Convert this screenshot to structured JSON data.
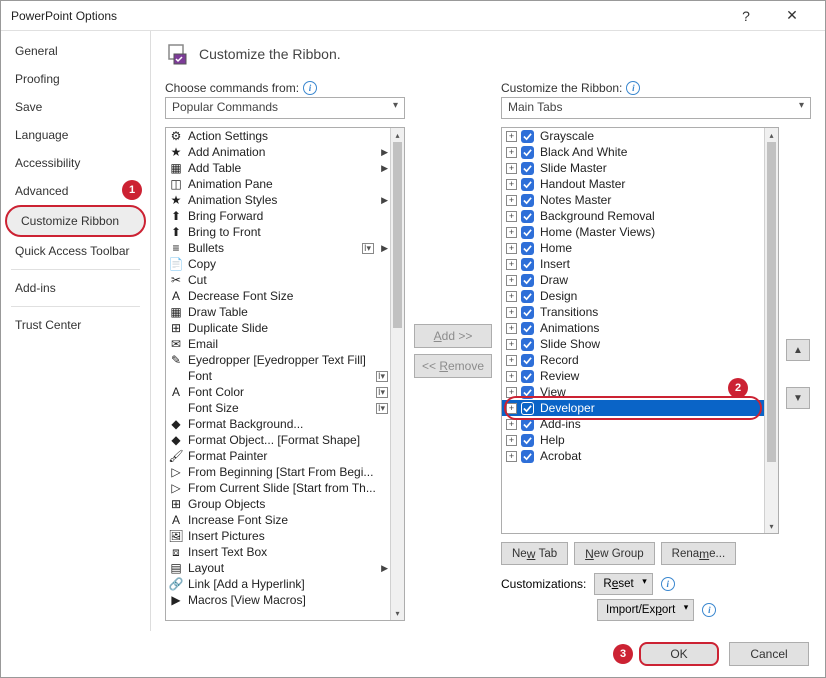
{
  "title": "PowerPoint Options",
  "sidebar": {
    "items": [
      {
        "label": "General"
      },
      {
        "label": "Proofing"
      },
      {
        "label": "Save"
      },
      {
        "label": "Language"
      },
      {
        "label": "Accessibility"
      },
      {
        "label": "Advanced"
      },
      {
        "label": "Customize Ribbon"
      },
      {
        "label": "Quick Access Toolbar"
      },
      {
        "label": "Add-ins"
      },
      {
        "label": "Trust Center"
      }
    ]
  },
  "header": "Customize the Ribbon.",
  "left": {
    "label": "Choose commands from:",
    "dropdown": "Popular Commands",
    "commands": [
      {
        "icon": "⚙",
        "label": "Action Settings"
      },
      {
        "icon": "★",
        "label": "Add Animation",
        "sub": true
      },
      {
        "icon": "▦",
        "label": "Add Table",
        "sub": true
      },
      {
        "icon": "◫",
        "label": "Animation Pane"
      },
      {
        "icon": "★",
        "label": "Animation Styles",
        "sub": true
      },
      {
        "icon": "⬆",
        "label": "Bring Forward"
      },
      {
        "icon": "⬆",
        "label": "Bring to Front"
      },
      {
        "icon": "≡",
        "label": "Bullets",
        "sub": true,
        "size": true
      },
      {
        "icon": "📄",
        "label": "Copy"
      },
      {
        "icon": "✂",
        "label": "Cut"
      },
      {
        "icon": "A",
        "label": "Decrease Font Size"
      },
      {
        "icon": "▦",
        "label": "Draw Table"
      },
      {
        "icon": "⊞",
        "label": "Duplicate Slide"
      },
      {
        "icon": "✉",
        "label": "Email"
      },
      {
        "icon": "✎",
        "label": "Eyedropper [Eyedropper Text Fill]"
      },
      {
        "icon": " ",
        "label": "Font",
        "size": true
      },
      {
        "icon": "A",
        "label": "Font Color",
        "size": true
      },
      {
        "icon": " ",
        "label": "Font Size",
        "size": true
      },
      {
        "icon": "◆",
        "label": "Format Background..."
      },
      {
        "icon": "◆",
        "label": "Format Object... [Format Shape]"
      },
      {
        "icon": "🖌",
        "label": "Format Painter"
      },
      {
        "icon": "▷",
        "label": "From Beginning [Start From Begi..."
      },
      {
        "icon": "▷",
        "label": "From Current Slide [Start from Th..."
      },
      {
        "icon": "⊞",
        "label": "Group Objects"
      },
      {
        "icon": "A",
        "label": "Increase Font Size"
      },
      {
        "icon": "🖼",
        "label": "Insert Pictures"
      },
      {
        "icon": "⧈",
        "label": "Insert Text Box"
      },
      {
        "icon": "▤",
        "label": "Layout",
        "sub": true
      },
      {
        "icon": "🔗",
        "label": "Link [Add a Hyperlink]"
      },
      {
        "icon": "▶",
        "label": "Macros [View Macros]"
      }
    ]
  },
  "mid": {
    "add": "Add >>",
    "remove": "<< Remove"
  },
  "right": {
    "label": "Customize the Ribbon:",
    "dropdown": "Main Tabs",
    "tabs": [
      "Grayscale",
      "Black And White",
      "Slide Master",
      "Handout Master",
      "Notes Master",
      "Background Removal",
      "Home (Master Views)",
      "Home",
      "Insert",
      "Draw",
      "Design",
      "Transitions",
      "Animations",
      "Slide Show",
      "Record",
      "Review",
      "View",
      "Developer",
      "Add-ins",
      "Help",
      "Acrobat"
    ],
    "selected_index": 17,
    "newtab": "New Tab",
    "newgroup": "New Group",
    "rename": "Rename...",
    "cust_label": "Customizations:",
    "reset": "Reset",
    "impexp": "Import/Export"
  },
  "footer": {
    "ok": "OK",
    "cancel": "Cancel"
  },
  "callouts": {
    "c1": "1",
    "c2": "2",
    "c3": "3"
  }
}
